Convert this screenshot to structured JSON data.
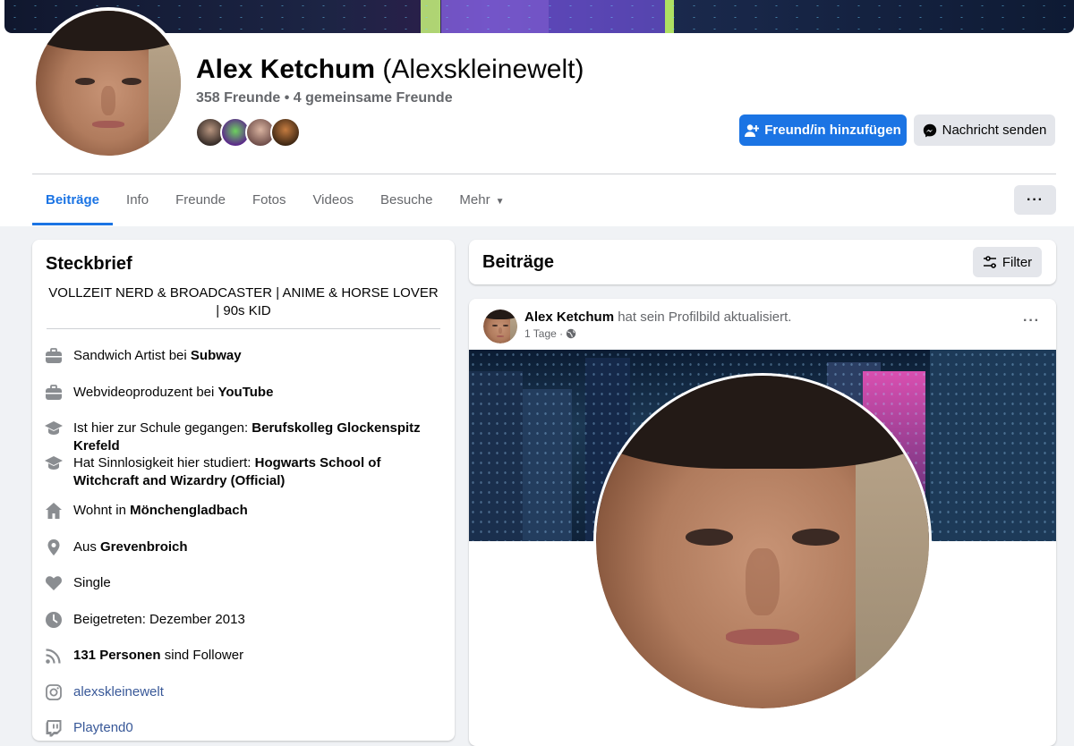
{
  "profile": {
    "name": "Alex Ketchum",
    "alt_name": "(Alexskleinewelt)",
    "friends_summary": "358 Freunde • 4 gemeinsame Freunde",
    "add_friend_label": "Freund/in hinzufügen",
    "message_label": "Nachricht senden"
  },
  "tabs": [
    {
      "label": "Beiträge"
    },
    {
      "label": "Info"
    },
    {
      "label": "Freunde"
    },
    {
      "label": "Fotos"
    },
    {
      "label": "Videos"
    },
    {
      "label": "Besuche"
    },
    {
      "label": "Mehr"
    }
  ],
  "more_button_label": "···",
  "intro": {
    "title": "Steckbrief",
    "bio": "VOLLZEIT NERD & BROADCASTER | ANIME & HORSE LOVER | 90s KID",
    "items": [
      {
        "icon": "briefcase-icon",
        "prefix": "Sandwich Artist bei ",
        "bold": "Subway"
      },
      {
        "icon": "briefcase-icon",
        "prefix": "Webvideoproduzent bei ",
        "bold": "YouTube"
      },
      {
        "icon": "graduation-cap-icon",
        "prefix": "Ist hier zur Schule gegangen: ",
        "bold": "Berufskolleg Glockenspitz Krefeld"
      },
      {
        "icon": "graduation-cap-icon",
        "prefix": "Hat Sinnlosigkeit hier studiert: ",
        "bold": "Hogwarts School of Witchcraft and Wizardry (Official)"
      },
      {
        "icon": "home-icon",
        "prefix": "Wohnt in ",
        "bold": "Mönchengladbach"
      },
      {
        "icon": "location-pin-icon",
        "prefix": "Aus ",
        "bold": "Grevenbroich"
      },
      {
        "icon": "heart-icon",
        "prefix": "Single",
        "bold": ""
      },
      {
        "icon": "clock-icon",
        "prefix": "Beigetreten: Dezember 2013",
        "bold": ""
      },
      {
        "icon": "rss-icon",
        "bold_first": "131 Personen",
        "suffix": " sind Follower"
      },
      {
        "icon": "instagram-icon",
        "link": "alexskleinewelt"
      },
      {
        "icon": "twitch-icon",
        "link": "Playtend0"
      }
    ]
  },
  "feed": {
    "title": "Beiträge",
    "filter_label": "Filter"
  },
  "post": {
    "author": "Alex Ketchum",
    "action": " hat sein Profilbild aktualisiert.",
    "time": "1 Tage ·",
    "menu_label": "···"
  },
  "colors": {
    "accent": "#1b74e4",
    "page_bg": "#f0f2f5",
    "secondary_text": "#65676b"
  }
}
